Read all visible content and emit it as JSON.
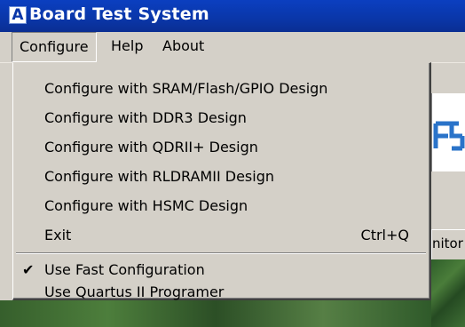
{
  "window": {
    "title": "Board Test System",
    "icon_letter": "A",
    "icon": "app-logo-icon"
  },
  "menubar": {
    "items": [
      {
        "label": "Configure"
      },
      {
        "label": "Help"
      },
      {
        "label": "About"
      }
    ]
  },
  "dropdown": {
    "items": [
      {
        "label": "Configure with SRAM/Flash/GPIO Design"
      },
      {
        "label": "Configure with DDR3 Design"
      },
      {
        "label": "Configure with QDRII+ Design"
      },
      {
        "label": "Configure with RLDRAMII Design"
      },
      {
        "label": "Configure with HSMC Design"
      },
      {
        "label": "Exit",
        "shortcut": "Ctrl+Q"
      },
      {
        "label": "Use Fast Configuration",
        "checked": true,
        "check_glyph": "✔"
      },
      {
        "label": "Use Quartus II Programer",
        "checked": false
      }
    ]
  },
  "background": {
    "tab_partial": "nitor"
  },
  "colors": {
    "titlebar": "#0a36a8",
    "menu_bg": "#d4d0c8",
    "board_logo": "#2a73c9"
  }
}
